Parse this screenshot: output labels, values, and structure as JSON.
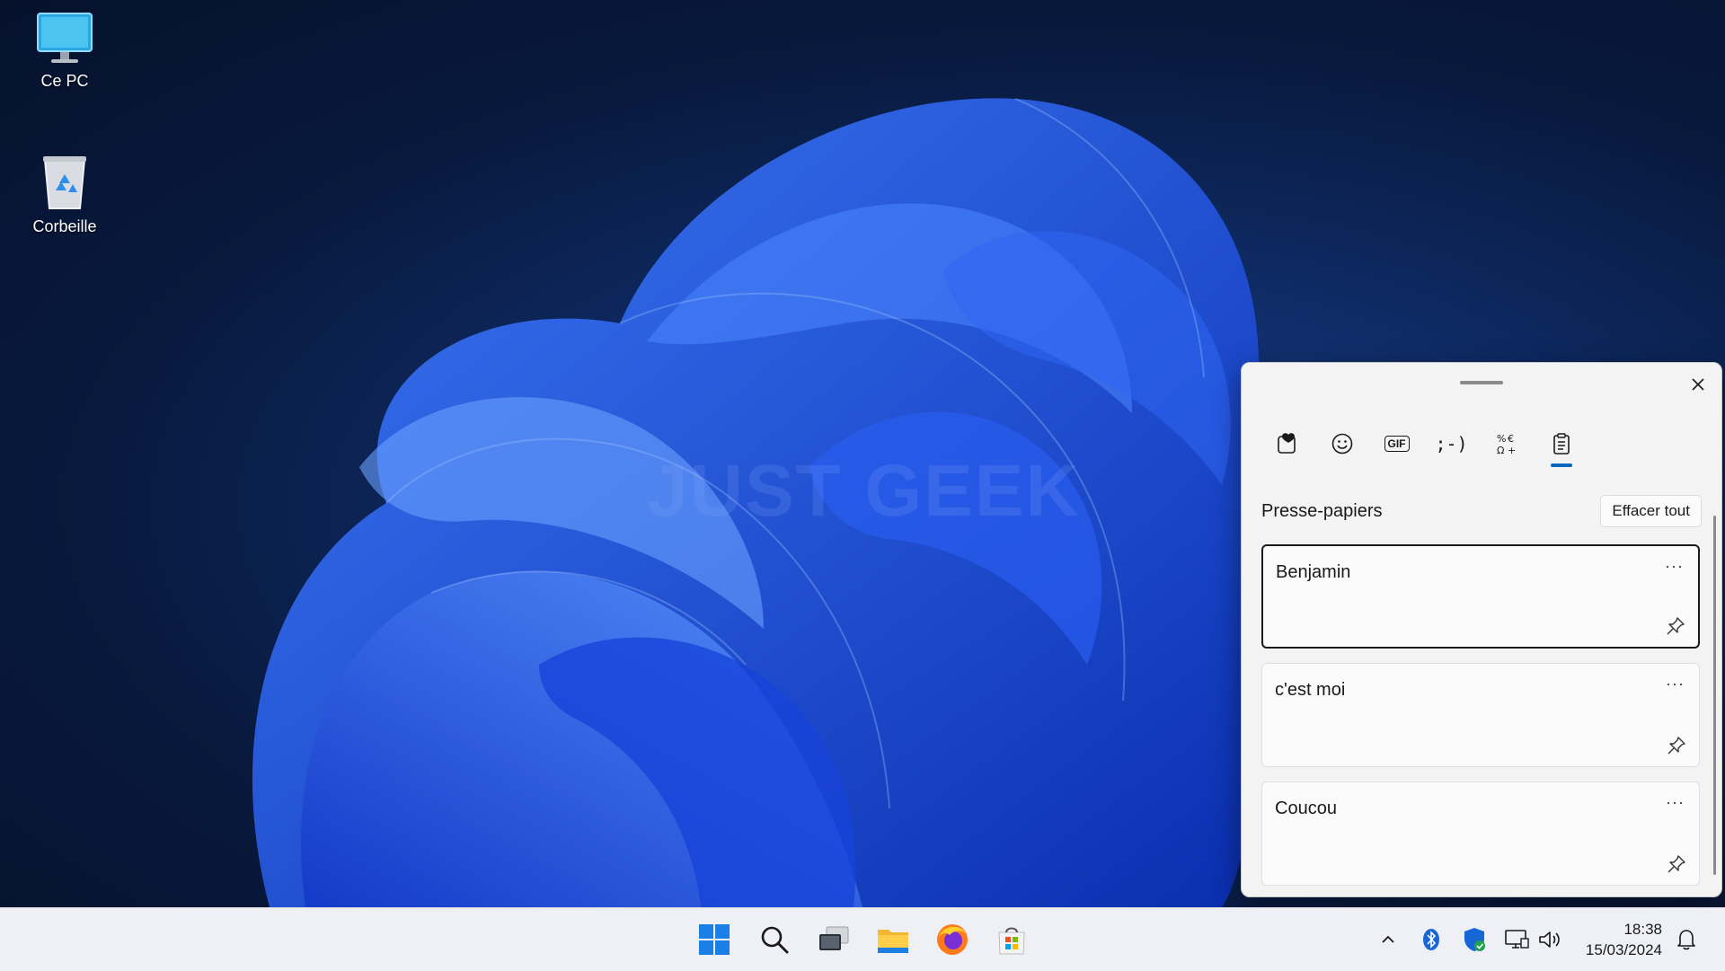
{
  "desktop": {
    "icons": [
      {
        "label": "Ce PC",
        "icon": "monitor-icon"
      },
      {
        "label": "Corbeille",
        "icon": "recycle-bin-icon"
      }
    ],
    "watermark": "JUST GEEK"
  },
  "panel": {
    "tabs": [
      {
        "name": "favorites-icon",
        "active": false
      },
      {
        "name": "emoji-icon",
        "active": false
      },
      {
        "name": "gif-icon",
        "active": false
      },
      {
        "name": "kaomoji-icon",
        "active": false
      },
      {
        "name": "symbols-icon",
        "active": false
      },
      {
        "name": "clipboard-icon",
        "active": true
      }
    ],
    "gif_label": "GIF",
    "kaomoji_label": ";-)",
    "title": "Presse-papiers",
    "clear_label": "Effacer tout",
    "items": [
      {
        "text": "Benjamin",
        "selected": true
      },
      {
        "text": "c'est moi",
        "selected": false
      },
      {
        "text": "Coucou",
        "selected": false
      }
    ],
    "more_label": "···"
  },
  "taskbar": {
    "apps": [
      "start-icon",
      "search-icon",
      "task-view-icon",
      "file-explorer-icon",
      "firefox-icon",
      "microsoft-store-icon"
    ],
    "tray": [
      "chevron-up-icon",
      "bluetooth-icon",
      "security-shield-icon",
      "network-icon",
      "volume-icon"
    ],
    "time": "18:38",
    "date": "15/03/2024"
  },
  "colors": {
    "accent": "#0067c0",
    "wallpaper": "#1e50e8"
  }
}
